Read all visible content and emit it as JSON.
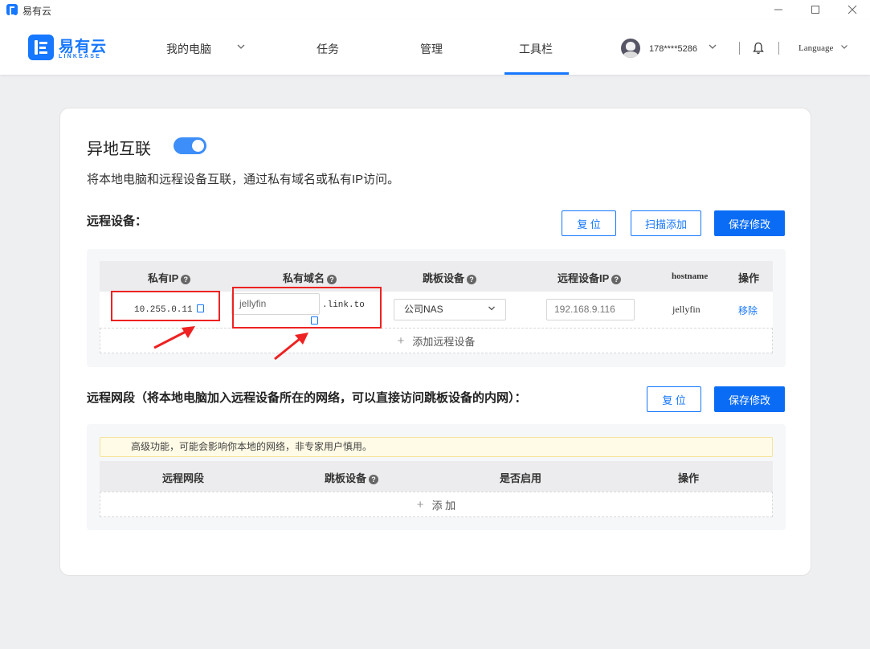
{
  "window": {
    "title": "易有云"
  },
  "brand": {
    "name": "易有云",
    "sub": "LINKEASE"
  },
  "nav": {
    "items": [
      {
        "label": "我的电脑"
      },
      {
        "label": "任务"
      },
      {
        "label": "管理"
      },
      {
        "label": "工具栏"
      }
    ],
    "active": "工具栏"
  },
  "user": {
    "name": "178****5286",
    "language": "Language"
  },
  "page": {
    "title": "异地互联",
    "toggle_on": true,
    "description": "将本地电脑和远程设备互联，通过私有域名或私有IP访问。"
  },
  "remote_devices": {
    "title": "远程设备：",
    "buttons": {
      "reset": "复 位",
      "scan_add": "扫描添加",
      "save": "保存修改"
    },
    "columns": {
      "ip": "私有IP",
      "domain": "私有域名",
      "jump": "跳板设备",
      "remote_ip": "远程设备IP",
      "hostname": "hostname",
      "action": "操作"
    },
    "rows": [
      {
        "ip": "10.255.0.11",
        "domain": "jellyfin",
        "suffix": ".link.to",
        "jump": "公司NAS",
        "remote_ip": "192.168.9.116",
        "hostname": "jellyfin",
        "action": "移除"
      }
    ],
    "add_label": "添加远程设备"
  },
  "remote_segments": {
    "title": "远程网段（将本地电脑加入远程设备所在的网络，可以直接访问跳板设备的内网）：",
    "buttons": {
      "reset": "复 位",
      "save": "保存修改"
    },
    "warning": "高级功能，可能会影响你本地的网络，非专家用户慎用。",
    "columns": {
      "segment": "远程网段",
      "jump": "跳板设备",
      "enabled": "是否启用",
      "action": "操作"
    },
    "add_label": "添 加"
  },
  "colors": {
    "accent": "#1677ff",
    "annotation": "#ee2222"
  }
}
